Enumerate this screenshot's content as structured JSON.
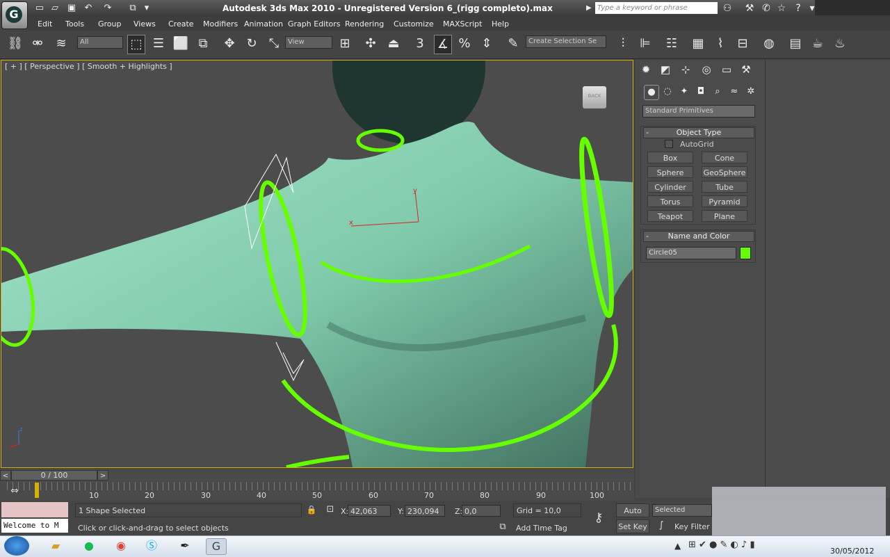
{
  "title": "Autodesk 3ds Max  2010  - Unregistered Version    6_(rigg completo).max",
  "search": {
    "placeholder": "Type a keyword or phrase"
  },
  "menu": [
    "Edit",
    "Tools",
    "Group",
    "Views",
    "Create",
    "Modifiers",
    "Animation",
    "Graph Editors",
    "Rendering",
    "Customize",
    "MAXScript",
    "Help"
  ],
  "toolbar": {
    "filter_value": "All",
    "ref_coord_value": "View",
    "snap_label": "3",
    "selection_set_placeholder": "Create Selection Se"
  },
  "viewport": {
    "label": "[ + ] [ Perspective ] [ Smooth + Highlights ]",
    "viewcube_label": "BACK",
    "axis_x": "x",
    "axis_y": "y",
    "axis_z": "z"
  },
  "command_panel": {
    "category_dropdown": "Standard Primitives",
    "object_type_title": "Object Type",
    "autogrid_label": "AutoGrid",
    "buttons": [
      "Box",
      "Cone",
      "Sphere",
      "GeoSphere",
      "Cylinder",
      "Tube",
      "Torus",
      "Pyramid",
      "Teapot",
      "Plane"
    ],
    "name_color_title": "Name and Color",
    "object_name": "Circle05",
    "object_color": "#66ff00",
    "rollout_toggle": "-"
  },
  "timeline": {
    "frame_counter": "0 / 100",
    "ticks": [
      "10",
      "20",
      "30",
      "40",
      "50",
      "60",
      "70",
      "80",
      "90",
      "100"
    ]
  },
  "status": {
    "maxscript_text": "Welcome to M",
    "selection_text": "1 Shape Selected",
    "prompt_text": "Click or click-and-drag to select objects",
    "x_label": "X:",
    "x_value": "42,063",
    "y_label": "Y:",
    "y_value": "230,094",
    "z_label": "Z:",
    "z_value": "0,0",
    "grid_text": "Grid = 10,0",
    "add_time_tag": "Add Time Tag",
    "auto_key": "Auto Key",
    "set_key": "Set Key",
    "key_mode_value": "Selected",
    "key_filters": "Key Filter"
  },
  "taskbar": {
    "date": "30/05/2012"
  },
  "colors": {
    "accent": "#66ff00",
    "skin": "#7fc9aa",
    "viewport_border": "#d4b000"
  }
}
